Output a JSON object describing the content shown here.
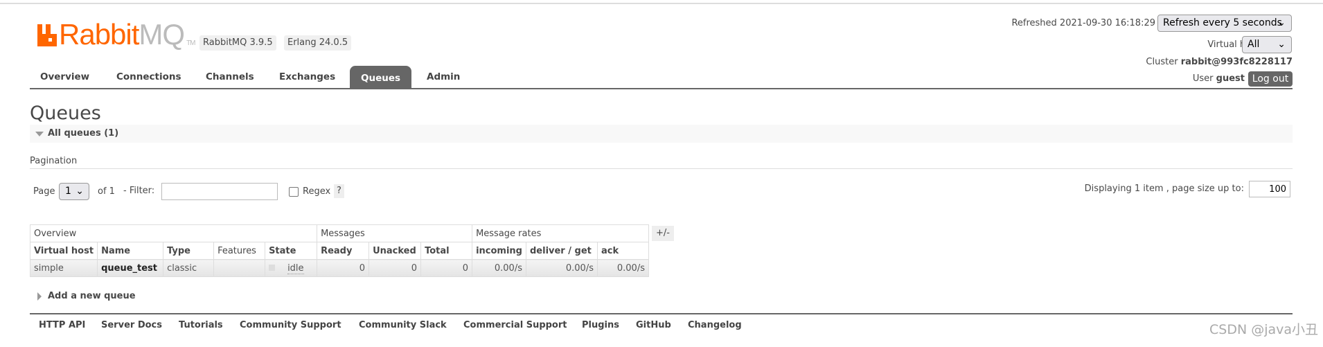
{
  "header": {
    "logo": {
      "brand_a": "Rabbit",
      "brand_b": "MQ",
      "tm": "TM"
    },
    "version_badges": [
      "RabbitMQ 3.9.5",
      "Erlang 24.0.5"
    ],
    "refreshed": "Refreshed 2021-09-30 16:18:29",
    "refresh_select": "Refresh every 5 seconds",
    "vhost_label": "Virtual host",
    "vhost_select": "All",
    "cluster_label": "Cluster",
    "cluster_name": "rabbit@993fc8228117",
    "user_label": "User",
    "user_name": "guest",
    "logout": "Log out"
  },
  "tabs": [
    {
      "label": "Overview"
    },
    {
      "label": "Connections"
    },
    {
      "label": "Channels"
    },
    {
      "label": "Exchanges"
    },
    {
      "label": "Queues",
      "active": true
    },
    {
      "label": "Admin"
    }
  ],
  "page": {
    "title": "Queues",
    "section": "All queues (1)",
    "pagination_label": "Pagination",
    "page_label": "Page",
    "page_value": "1",
    "of": "of 1",
    "filter_label": "- Filter:",
    "filter_value": "",
    "regex_label": "Regex",
    "regex_checked": false,
    "help": "?",
    "displaying": "Displaying 1 item , page size up to:",
    "page_size": "100",
    "add_queue": "Add a new queue"
  },
  "table": {
    "groups": [
      "Overview",
      "Messages",
      "Message rates"
    ],
    "toggle": "+/-",
    "columns": [
      "Virtual host",
      "Name",
      "Type",
      "Features",
      "State",
      "Ready",
      "Unacked",
      "Total",
      "incoming",
      "deliver / get",
      "ack"
    ],
    "rows": [
      [
        "simple",
        "queue_test",
        "classic",
        "",
        "idle",
        "0",
        "0",
        "0",
        "0.00/s",
        "0.00/s",
        "0.00/s"
      ]
    ]
  },
  "footer": [
    "HTTP API",
    "Server Docs",
    "Tutorials",
    "Community Support",
    "Community Slack",
    "Commercial Support",
    "Plugins",
    "GitHub",
    "Changelog"
  ],
  "watermark": "CSDN @java小丑",
  "colors": {
    "brand": "#ff6600",
    "tab_active": "#666666"
  }
}
